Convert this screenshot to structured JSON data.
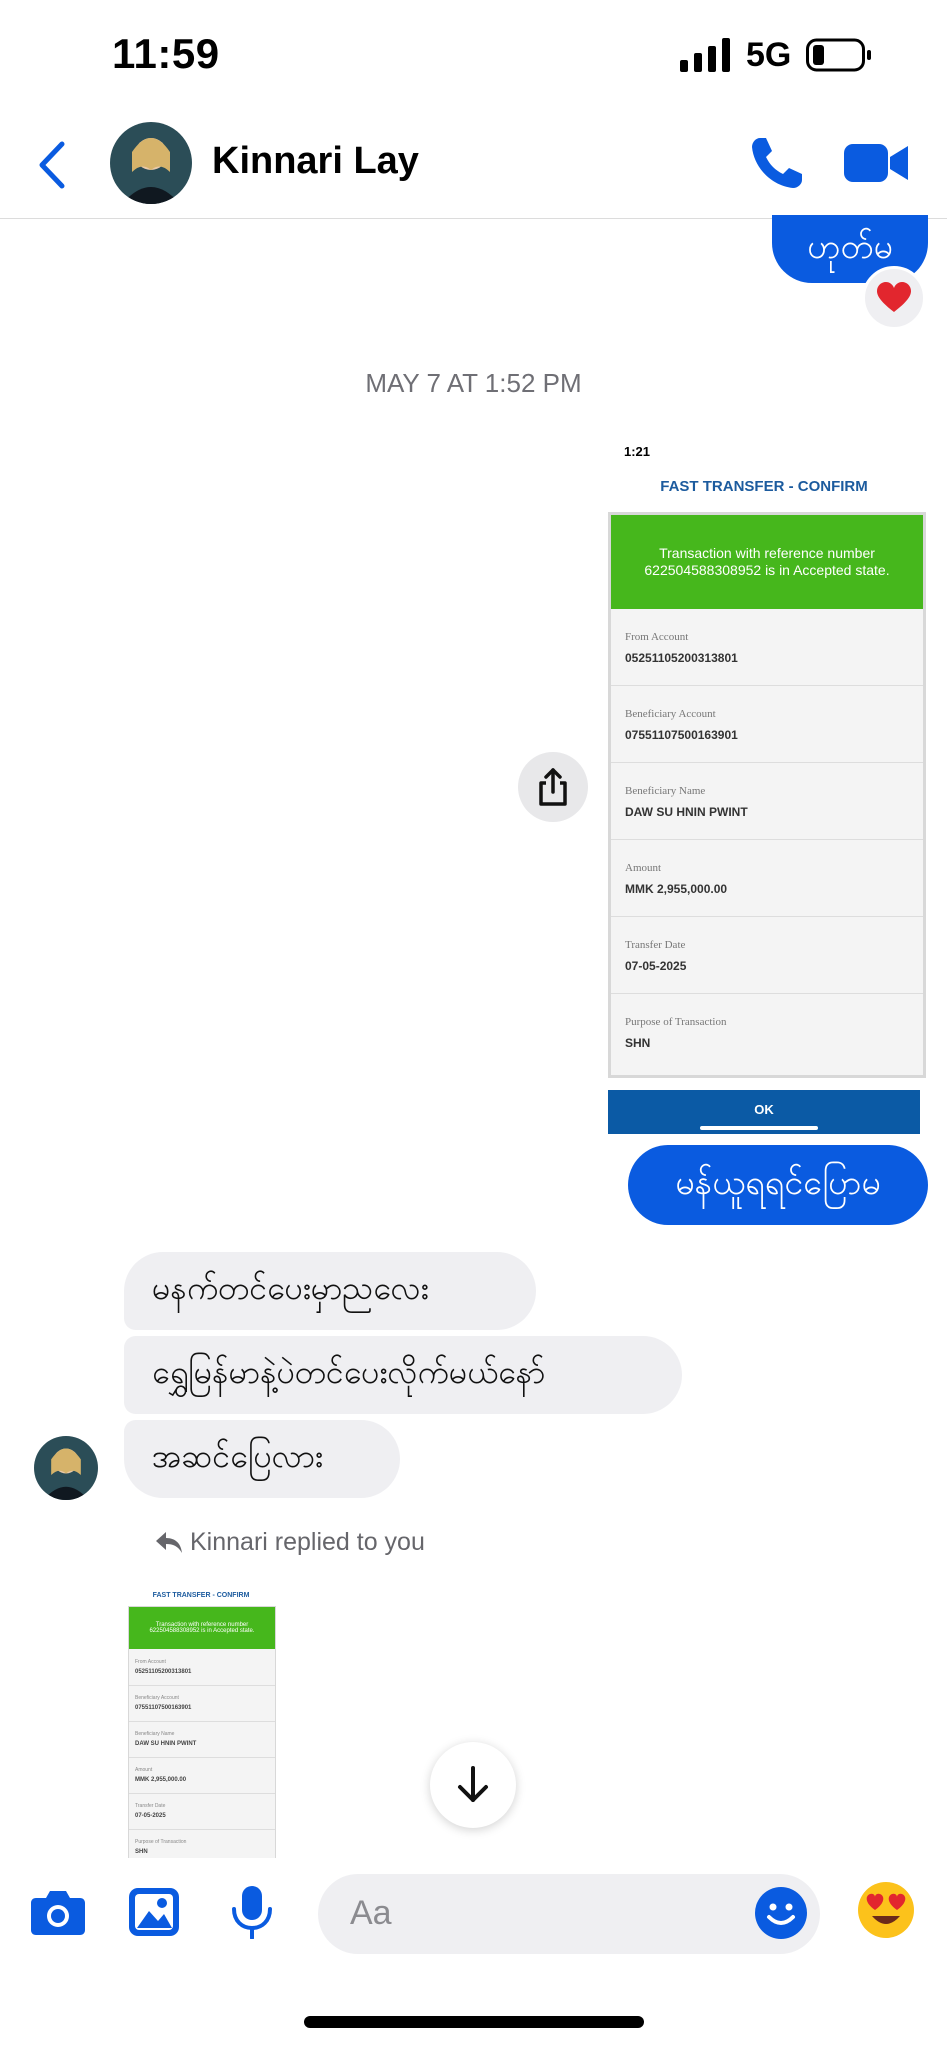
{
  "status": {
    "time": "11:59",
    "network": "5G"
  },
  "header": {
    "contact_name": "Kinnari Lay"
  },
  "messages": {
    "out1": "ဟုတ်မ",
    "reaction": "❤️",
    "timestamp": "MAY 7 AT 1:52 PM",
    "out2": "မန်ယူရရင်ပြောမ",
    "in1": "မနက်တင်ပေးမှာညလေး",
    "in2": "ရွှေမြန်မာနဲ့ပဲတင်ပေးလိုက်မယ်နော်",
    "in3": "အဆင်ပြေလား",
    "reply_note": "Kinnari replied to you"
  },
  "screenshot": {
    "time": "1:21",
    "title": "FAST TRANSFER - CONFIRM",
    "banner": "Transaction with reference  number 622504588308952 is in Accepted state.",
    "fields": [
      {
        "label": "From Account",
        "value": "05251105200313801"
      },
      {
        "label": "Beneficiary Account",
        "value": "07551107500163901"
      },
      {
        "label": "Beneficiary Name",
        "value": "DAW SU HNIN PWINT"
      },
      {
        "label": "Amount",
        "value": "MMK 2,955,000.00"
      },
      {
        "label": "Transfer Date",
        "value": "07-05-2025"
      },
      {
        "label": "Purpose of Transaction",
        "value": "SHN"
      }
    ],
    "ok": "OK"
  },
  "composer": {
    "placeholder": "Aa"
  },
  "colors": {
    "accent": "#0a5be0",
    "incoming": "#efeff2",
    "success": "#46b71c",
    "bank_blue": "#0b5aa5"
  }
}
